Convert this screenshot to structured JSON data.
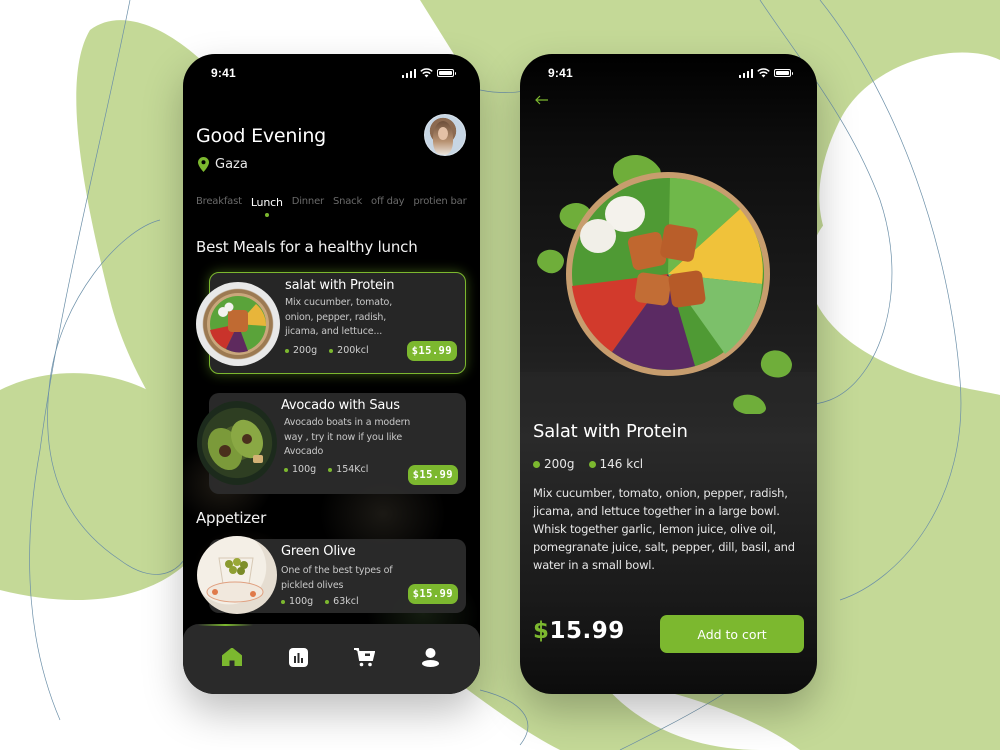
{
  "theme": {
    "accent": "#7cb82f",
    "background_green": "#c4d997",
    "phone_bg": "#000000",
    "card_bg": "#2c2c2c"
  },
  "home_screen": {
    "status_bar": {
      "time": "9:41",
      "icons": [
        "cellular-signal-icon",
        "wifi-icon",
        "battery-icon"
      ]
    },
    "greeting": "Good Evening",
    "location": {
      "icon": "map-pin-icon",
      "label": "Gaza"
    },
    "avatar": {
      "icon": "user-avatar"
    },
    "tabs": [
      {
        "label": "Breakfast",
        "active": false
      },
      {
        "label": "Lunch",
        "active": true
      },
      {
        "label": "Dinner",
        "active": false
      },
      {
        "label": "Snack",
        "active": false
      },
      {
        "label": "off day",
        "active": false
      },
      {
        "label": "protien bar",
        "active": false
      }
    ],
    "section_best": "Best Meals for a healthy lunch",
    "section_appetizer": "Appetizer",
    "meals": [
      {
        "name": "salat with Protein",
        "description": "Mix cucumber, tomato, onion, pepper, radish, jicama, and lettuce...",
        "weight": "200g",
        "calories": "200kcl",
        "price": "$15.99",
        "featured": true
      },
      {
        "name": "Avocado with Saus",
        "description": "Avocado boats in a modern way , try it now if you like Avocado",
        "weight": "100g",
        "calories": "154Kcl",
        "price": "$15.99",
        "featured": false
      },
      {
        "name": "Green Olive",
        "description": "One of the best types of pickled olives",
        "weight": "100g",
        "calories": "63kcl",
        "price": "$15.99",
        "featured": false
      }
    ],
    "bottom_nav": [
      {
        "icon": "home-icon",
        "active": true
      },
      {
        "icon": "stats-icon",
        "active": false
      },
      {
        "icon": "cart-icon",
        "active": false
      },
      {
        "icon": "profile-icon",
        "active": false
      }
    ]
  },
  "detail_screen": {
    "status_bar": {
      "time": "9:41"
    },
    "back_icon": "arrow-left-icon",
    "title": "Salat with Protein",
    "weight": "200g",
    "calories": "146 kcl",
    "description": "Mix cucumber, tomato, onion, pepper, radish, jicama, and lettuce together in a large bowl. Whisk together garlic, lemon juice, olive oil, pomegranate juice, salt, pepper, dill, basil, and water in a small bowl.",
    "price_currency": "$",
    "price_value": "15.99",
    "add_button": "Add to cort"
  }
}
